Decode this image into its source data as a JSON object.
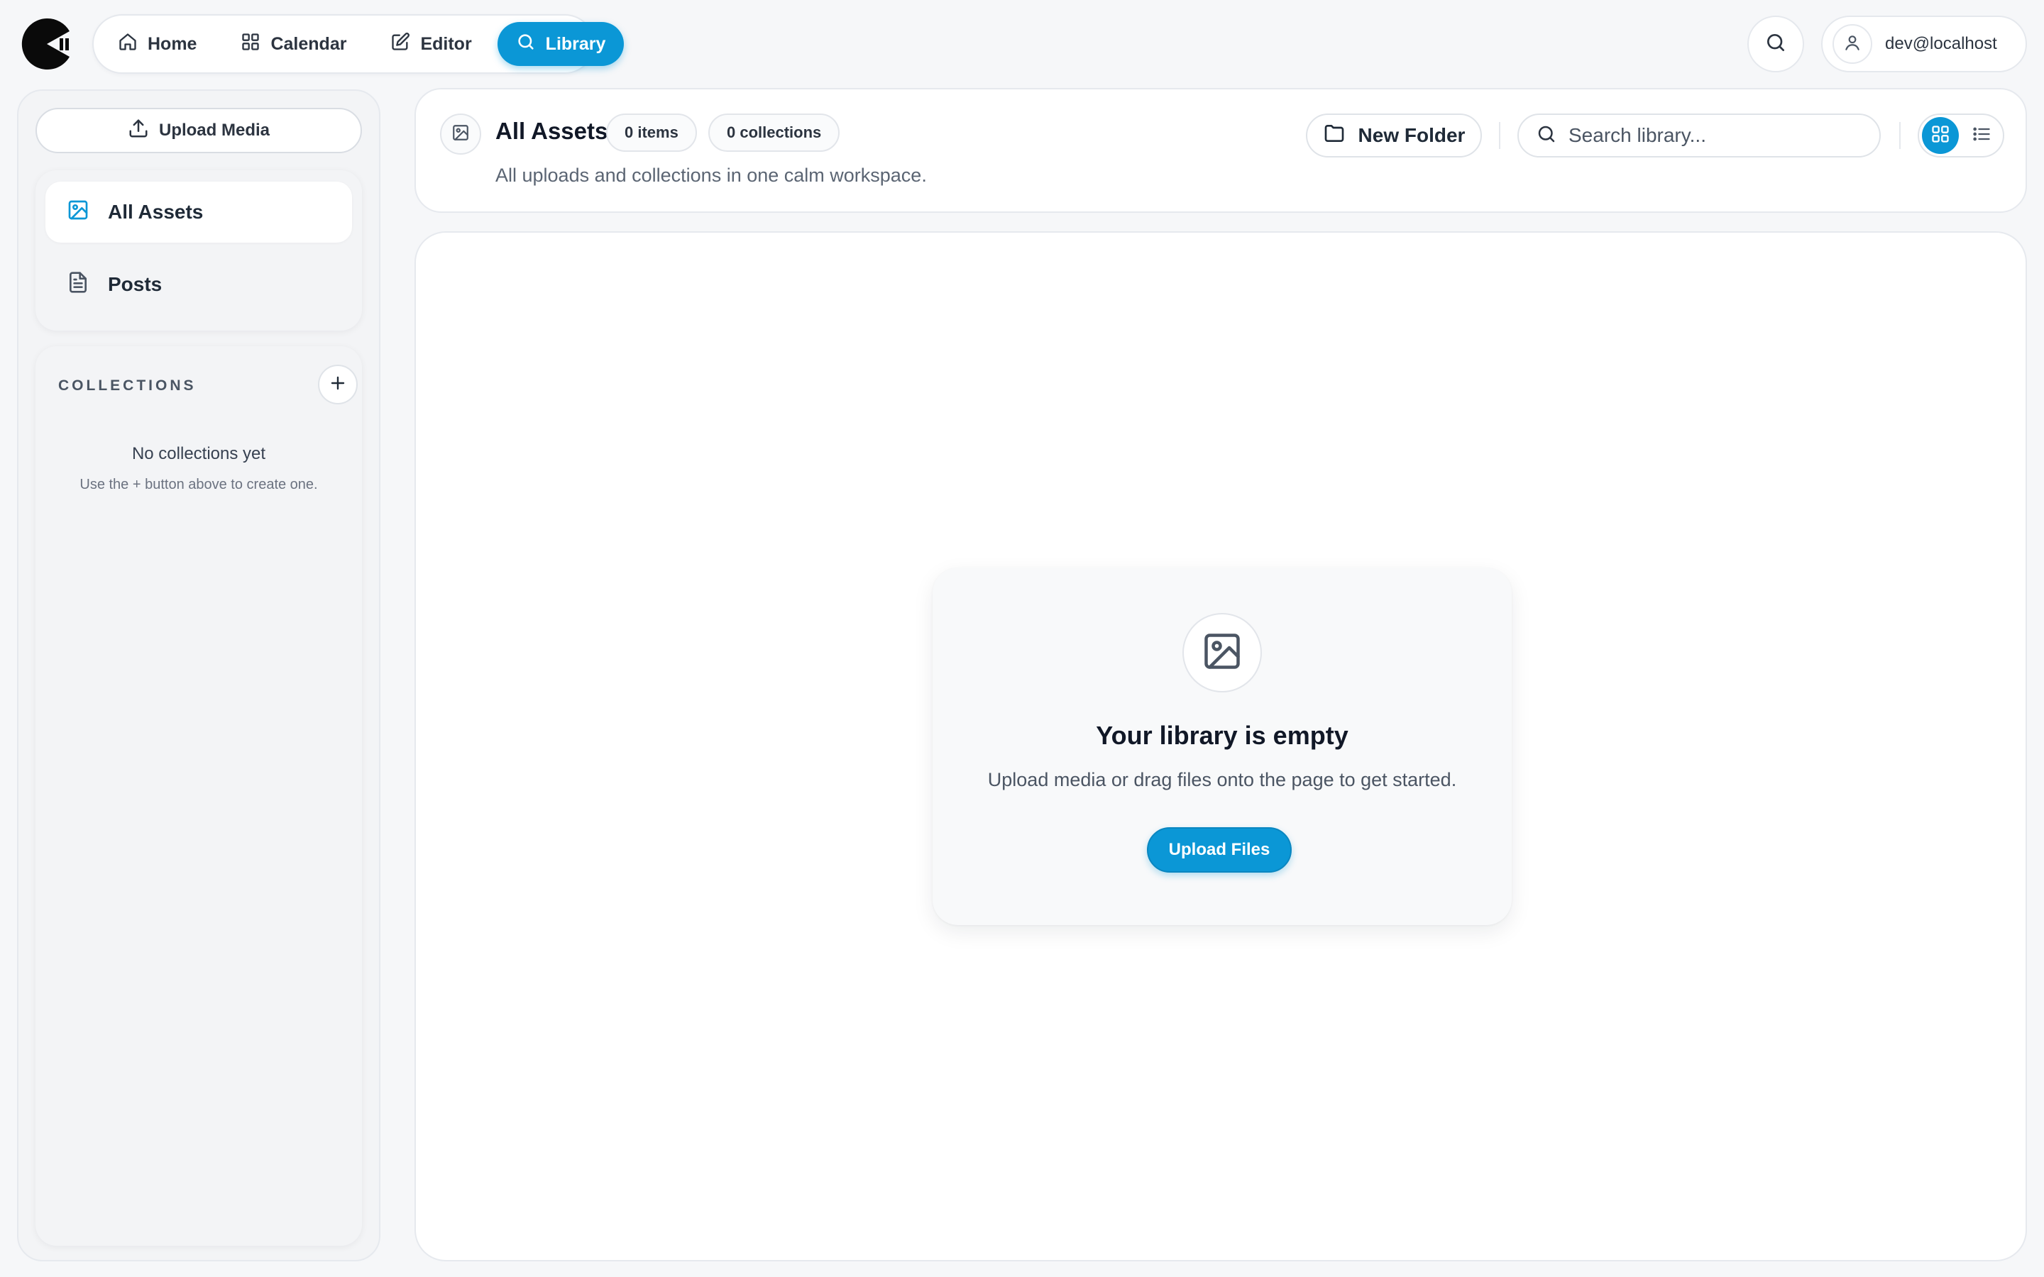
{
  "nav": {
    "items": [
      {
        "label": "Home",
        "icon": "home-icon"
      },
      {
        "label": "Calendar",
        "icon": "grid-icon"
      },
      {
        "label": "Editor",
        "icon": "edit-icon"
      },
      {
        "label": "Library",
        "icon": "search-icon",
        "active": true
      }
    ]
  },
  "user": {
    "email": "dev@localhost"
  },
  "sidebar": {
    "upload_label": "Upload Media",
    "items": [
      {
        "label": "All Assets",
        "icon": "image-icon",
        "active": true
      },
      {
        "label": "Posts",
        "icon": "document-icon"
      }
    ],
    "collections": {
      "title": "COLLECTIONS",
      "empty_title": "No collections yet",
      "empty_sub": "Use the + button above to create one."
    }
  },
  "header": {
    "title": "All Assets",
    "items_badge": "0 items",
    "collections_badge": "0 collections",
    "subtitle": "All uploads and collections in one calm workspace.",
    "new_folder_label": "New Folder",
    "search_placeholder": "Search library...",
    "view_mode": "grid"
  },
  "empty_state": {
    "title": "Your library is empty",
    "subtitle": "Upload media or drag files onto the page to get started.",
    "button_label": "Upload Files"
  },
  "colors": {
    "accent": "#0b97d6",
    "background": "#f6f7f9",
    "card": "#ffffff"
  }
}
